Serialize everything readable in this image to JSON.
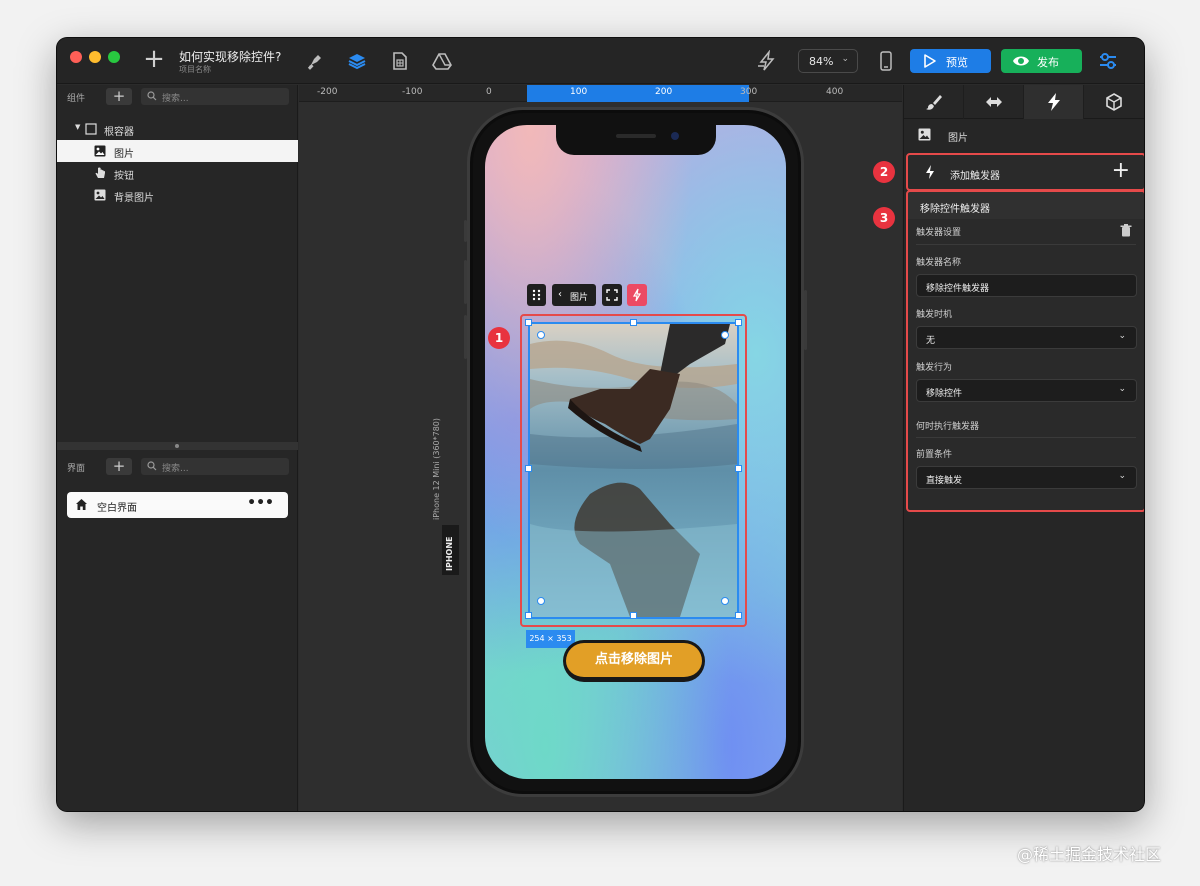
{
  "titlebar": {
    "project_title": "如何实现移除控件?",
    "project_subtitle": "项目名称",
    "zoom": "84%",
    "preview_label": "预览",
    "publish_label": "发布"
  },
  "left_panel": {
    "components_label": "组件",
    "search_placeholder": "搜索...",
    "tree": {
      "root": "根容器",
      "image": "图片",
      "button": "按钮",
      "bg_image": "背景图片"
    },
    "screens_label": "界面",
    "screens_search_placeholder": "搜索...",
    "screen_name": "空白界面",
    "screen_more": "•••"
  },
  "canvas": {
    "ruler_labels": [
      "-200",
      "-100",
      "0",
      "100",
      "200",
      "300",
      "400"
    ],
    "device_name": "iPhone 12 Mini (360*780)",
    "device_tag": "IPHONE",
    "toolbar_breadcrumb": "图片",
    "size_badge": "254 × 353",
    "action_button": "点击移除图片",
    "markers": [
      "1",
      "2",
      "3"
    ]
  },
  "right_panel": {
    "selected_type": "图片",
    "add_trigger": "添加触发器",
    "trigger_title": "移除控件触发器",
    "trigger_settings": "触发器设置",
    "name_label": "触发器名称",
    "name_value": "移除控件触发器",
    "timing_label": "触发时机",
    "timing_value": "无",
    "action_label": "触发行为",
    "action_value": "移除控件",
    "when_label": "何时执行触发器",
    "condition_label": "前置条件",
    "condition_value": "直接触发"
  },
  "colors": {
    "accent_blue": "#1e7de6",
    "publish_green": "#17b05a",
    "marker_red": "#e8333f",
    "button_orange": "#e29f26"
  },
  "watermark": "@稀土掘金技术社区"
}
